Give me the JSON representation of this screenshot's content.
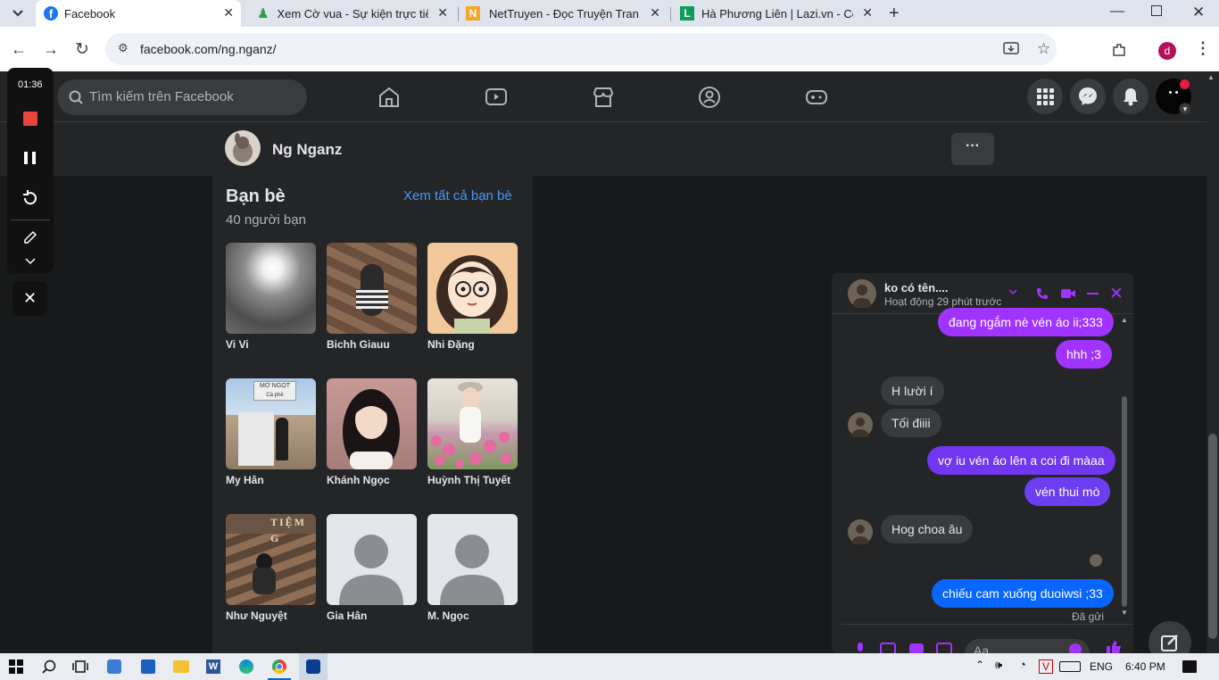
{
  "browser": {
    "tabs": [
      {
        "title": "Facebook"
      },
      {
        "title": "Xem Cờ vua - Sự kiện trực tiếp,"
      },
      {
        "title": "NetTruyen - Đọc Truyện Tranh C"
      },
      {
        "title": "Hà Phương Liên | Lazi.vn - Cộng"
      }
    ],
    "url": "facebook.com/ng.nganz/",
    "profile_initial": "d"
  },
  "recorder": {
    "time": "01:36"
  },
  "facebook": {
    "search_placeholder": "Tìm kiếm trên Facebook",
    "profile_name": "Ng Nganz",
    "more_button": "···"
  },
  "friends": {
    "title": "Bạn bè",
    "count": "40 người bạn",
    "see_all": "Xem tất cả bạn bè",
    "items": [
      {
        "name": "Vi Vi"
      },
      {
        "name": "Bichh Giauu"
      },
      {
        "name": "Nhi Đặng"
      },
      {
        "name": "My Hân"
      },
      {
        "name": "Khánh Ngọc"
      },
      {
        "name": "Huỳnh Thị Tuyết"
      },
      {
        "name": "Như Nguyệt"
      },
      {
        "name": "Gia Hân"
      },
      {
        "name": "M. Ngọc"
      }
    ],
    "sign_text": "MƠ NGỌT",
    "sign_sub": "Cà phê",
    "wall_text": "TIỆM G"
  },
  "chat": {
    "name": "ko có tên....",
    "status": "Hoạt động 29 phút trước",
    "messages": [
      {
        "text": "đang ngắm nè vén áo ii;333",
        "dir": "out"
      },
      {
        "text": "hhh ;3",
        "dir": "out"
      },
      {
        "text": "H lười í",
        "dir": "in"
      },
      {
        "text": "Tối điiii",
        "dir": "in"
      },
      {
        "text": "vợ iu vén áo lên a coi đi màaa",
        "dir": "out"
      },
      {
        "text": "vén thui mò",
        "dir": "out"
      },
      {
        "text": "Hog choa âu",
        "dir": "in"
      },
      {
        "text": "chiếu cam xuống duoiwsi ;33",
        "dir": "out"
      }
    ],
    "sent_label": "Đã gửi",
    "input_placeholder": "Aa",
    "colors": {
      "accent": "#a033ff",
      "accent_alt": "#0866ff"
    }
  },
  "taskbar": {
    "lang": "ENG",
    "time": "6:40 PM"
  }
}
